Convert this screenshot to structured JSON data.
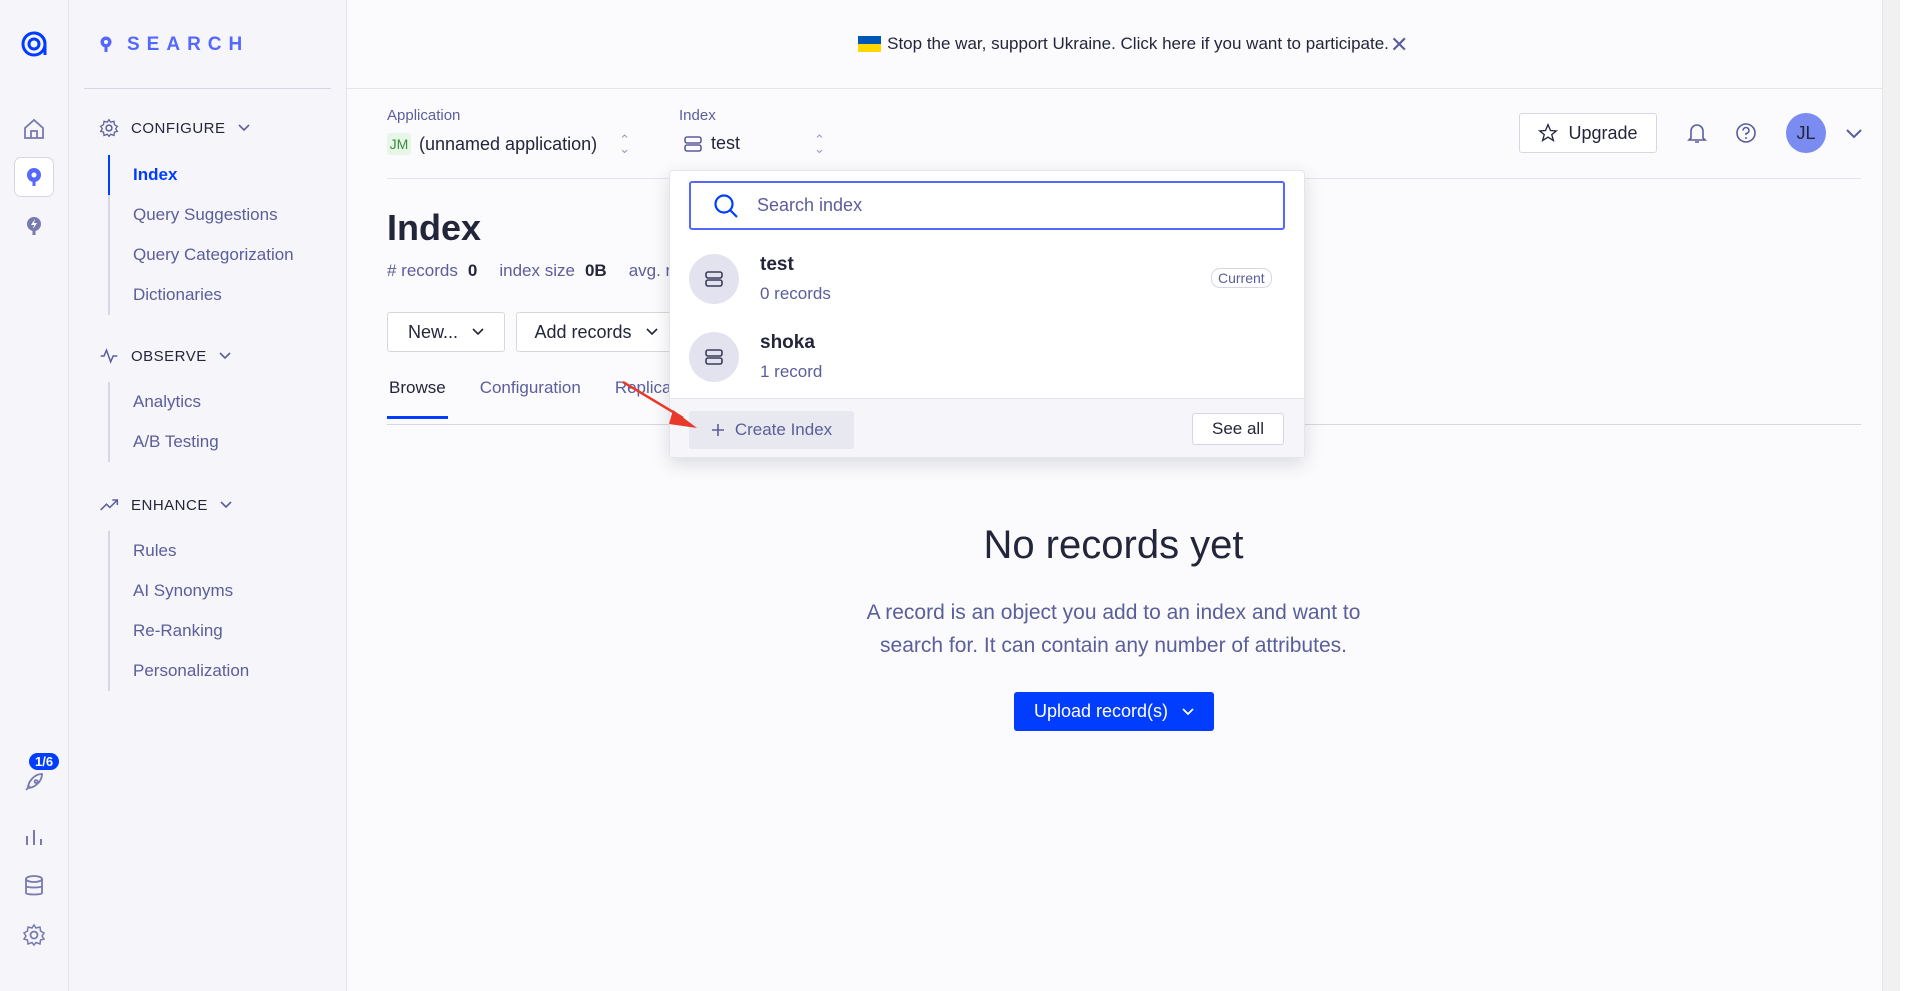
{
  "rail": {
    "icons": [
      "logo-icon",
      "home-icon",
      "search-product-icon",
      "generative-ai-icon",
      "rocket-icon",
      "chart-icon",
      "database-icon",
      "gear-icon"
    ],
    "badge": "1/6"
  },
  "nav": {
    "brand": "SEARCH",
    "configure": {
      "title": "CONFIGURE",
      "items": [
        "Index",
        "Query Suggestions",
        "Query Categorization",
        "Dictionaries"
      ]
    },
    "observe": {
      "title": "OBSERVE",
      "items": [
        "Analytics",
        "A/B Testing"
      ]
    },
    "enhance": {
      "title": "ENHANCE",
      "items": [
        "Rules",
        "AI Synonyms",
        "Re-Ranking",
        "Personalization"
      ]
    }
  },
  "banner": {
    "text": "Stop the war, support Ukraine. Click here if you want to participate.",
    "close": "✕"
  },
  "header": {
    "application_label": "Application",
    "application_badge": "JM",
    "application_value": "(unnamed application)",
    "index_label": "Index",
    "index_value": "test",
    "upgrade_label": "Upgrade",
    "avatar_initials": "JL"
  },
  "page": {
    "title": "Index",
    "stats": {
      "records_label": "# records",
      "records_value": "0",
      "size_label": "index size",
      "size_value": "0B",
      "avg_label": "avg. re"
    },
    "buttons": {
      "new": "New...",
      "add_records": "Add records"
    },
    "tabs": [
      "Browse",
      "Configuration",
      "Replicas"
    ],
    "empty": {
      "title": "No records yet",
      "desc_line1": "A record is an object you add to an index and want to",
      "desc_line2": "search for. It can contain any number of attributes.",
      "upload_label": "Upload record(s)"
    }
  },
  "dropdown": {
    "search_placeholder": "Search index",
    "items": [
      {
        "name": "test",
        "records": "0 records",
        "badge": "Current"
      },
      {
        "name": "shoka",
        "records": "1 record"
      }
    ],
    "create_label": "Create Index",
    "see_all_label": "See all"
  },
  "colors": {
    "accent": "#003dff",
    "brand": "#5468ff",
    "annotation_arrow": "#e8392b"
  }
}
